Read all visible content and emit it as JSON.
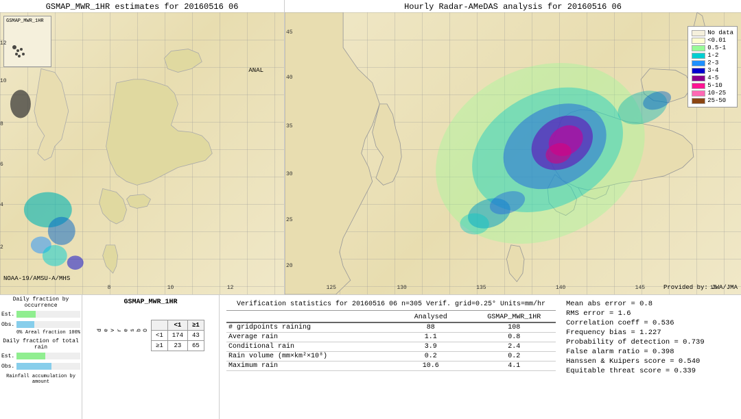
{
  "left_map": {
    "title": "GSMAP_MWR_1HR estimates for 20160516 06",
    "sat_label": "NOAA-19/AMSU-A/MHS",
    "anal_label": "ANAL",
    "inset_label": "GSMAP_MWR_1HR"
  },
  "right_map": {
    "title": "Hourly Radar-AMeDAS analysis for 20160516 06",
    "provided_by": "Provided by: JWA/JMA"
  },
  "legend": {
    "items": [
      {
        "label": "No data",
        "color": "#F5F0DC"
      },
      {
        "label": "<0.01",
        "color": "#FFFDD0"
      },
      {
        "label": "0.5-1",
        "color": "#98FB98"
      },
      {
        "label": "1-2",
        "color": "#00CED1"
      },
      {
        "label": "2-3",
        "color": "#1E90FF"
      },
      {
        "label": "3-4",
        "color": "#0000CD"
      },
      {
        "label": "4-5",
        "color": "#8B008B"
      },
      {
        "label": "5-10",
        "color": "#FF1493"
      },
      {
        "label": "10-25",
        "color": "#FF69B4"
      },
      {
        "label": "25-50",
        "color": "#8B4513"
      }
    ]
  },
  "bottom_charts": {
    "section1_title": "Daily fraction by occurrence",
    "est_label": "Est.",
    "obs_label": "Obs.",
    "pct_0": "0%",
    "areal_fraction": "Areal fraction",
    "pct_100": "100%",
    "section2_title": "Daily fraction of total rain",
    "rainfall_label": "Rainfall accumulation by amount"
  },
  "contingency": {
    "table_title": "GSMAP_MWR_1HR",
    "col_lt1": "<1",
    "col_ge1": "≥1",
    "row_lt1": "<1",
    "row_ge1": "≥1",
    "obs_label": "O\nb\ns\ne\nr\nv\ne\nd",
    "v11": "174",
    "v12": "43",
    "v21": "23",
    "v22": "65"
  },
  "verification": {
    "header": "Verification statistics for 20160516 06  n=305  Verif. grid=0.25°  Units=mm/hr",
    "col_analysed": "Analysed",
    "col_gsmap": "GSMAP_MWR_1HR",
    "rows": [
      {
        "label": "# gridpoints raining",
        "val1": "88",
        "val2": "108"
      },
      {
        "label": "Average rain",
        "val1": "1.1",
        "val2": "0.8"
      },
      {
        "label": "Conditional rain",
        "val1": "3.9",
        "val2": "2.4"
      },
      {
        "label": "Rain volume (mm×km²×10⁸)",
        "val1": "0.2",
        "val2": "0.2"
      },
      {
        "label": "Maximum rain",
        "val1": "10.6",
        "val2": "4.1"
      }
    ]
  },
  "right_stats": {
    "items": [
      "Mean abs error = 0.8",
      "RMS error = 1.6",
      "Correlation coeff = 0.536",
      "Frequency bias = 1.227",
      "Probability of detection = 0.739",
      "False alarm ratio = 0.398",
      "Hanssen & Kuipers score = 0.540",
      "Equitable threat score = 0.339"
    ]
  },
  "right_map_y_ticks": [
    "45",
    "40",
    "35",
    "30",
    "25",
    "20"
  ],
  "right_map_x_ticks": [
    "125",
    "130",
    "135",
    "140",
    "145",
    "15"
  ],
  "left_map_y_ticks": [
    "12",
    "10",
    "8",
    "6",
    "4",
    "2"
  ],
  "left_map_x_ticks": [
    "8",
    "10",
    "12"
  ]
}
